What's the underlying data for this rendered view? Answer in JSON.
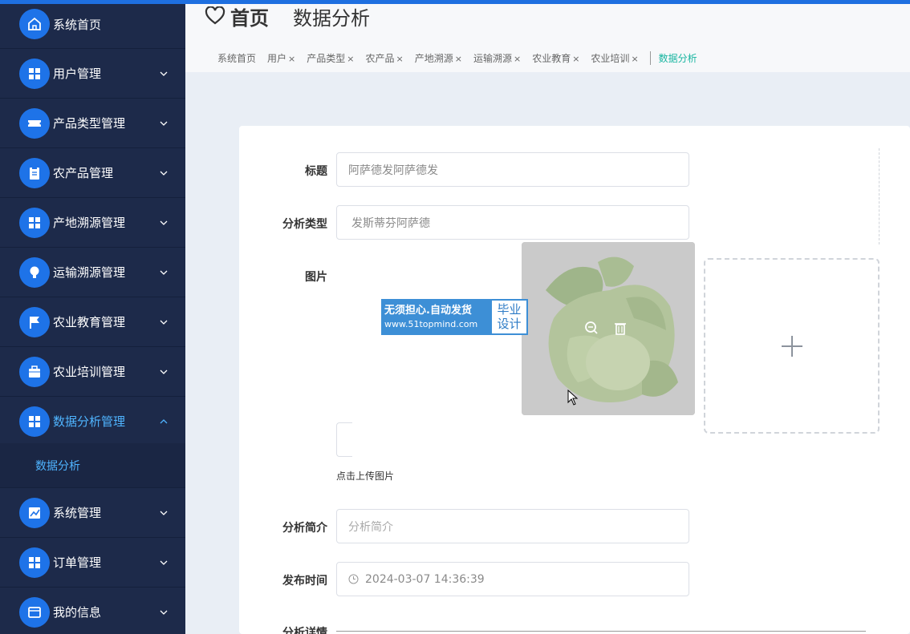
{
  "sidebar": {
    "items": [
      {
        "label": "系统首页",
        "icon": "home-icon"
      },
      {
        "label": "用户管理",
        "icon": "grid-icon"
      },
      {
        "label": "产品类型管理",
        "icon": "ticket-icon"
      },
      {
        "label": "农产品管理",
        "icon": "clipboard-icon"
      },
      {
        "label": "产地溯源管理",
        "icon": "grid-icon"
      },
      {
        "label": "运输溯源管理",
        "icon": "bulb-icon"
      },
      {
        "label": "农业教育管理",
        "icon": "flag-icon"
      },
      {
        "label": "农业培训管理",
        "icon": "briefcase-icon"
      },
      {
        "label": "数据分析管理",
        "icon": "grid-icon"
      },
      {
        "label": "系统管理",
        "icon": "chart-icon"
      },
      {
        "label": "订单管理",
        "icon": "grid-icon"
      },
      {
        "label": "我的信息",
        "icon": "card-icon"
      }
    ],
    "submenu": {
      "label": "数据分析"
    }
  },
  "header": {
    "home": "首页",
    "page_title": "数据分析",
    "tabs": [
      "系统首页",
      "用户",
      "产品类型",
      "农产品",
      "产地溯源",
      "运输溯源",
      "农业教育",
      "农业培训",
      "数据分析"
    ]
  },
  "form": {
    "title": {
      "label": "标题",
      "value": "阿萨德发阿萨德发"
    },
    "type": {
      "label": "分析类型",
      "value": "发斯蒂芬阿萨德"
    },
    "image": {
      "label": "图片",
      "tip": "点击上传图片"
    },
    "summary": {
      "label": "分析简介",
      "placeholder": "分析简介"
    },
    "publish_time": {
      "label": "发布时间",
      "value": "2024-03-07 14:36:39"
    },
    "detail": {
      "label": "分析详情"
    }
  },
  "watermark": {
    "line1": "无须担心.自动发货",
    "line2": "www.51topmind.com",
    "badge": "毕业设计"
  },
  "colors": {
    "sidebar_bg": "#1d2a4a",
    "icon_circle": "#1e73e8",
    "active_text": "#4fb4ff",
    "active_tab": "#18b5a0",
    "topbar": "#1e6fe0"
  }
}
